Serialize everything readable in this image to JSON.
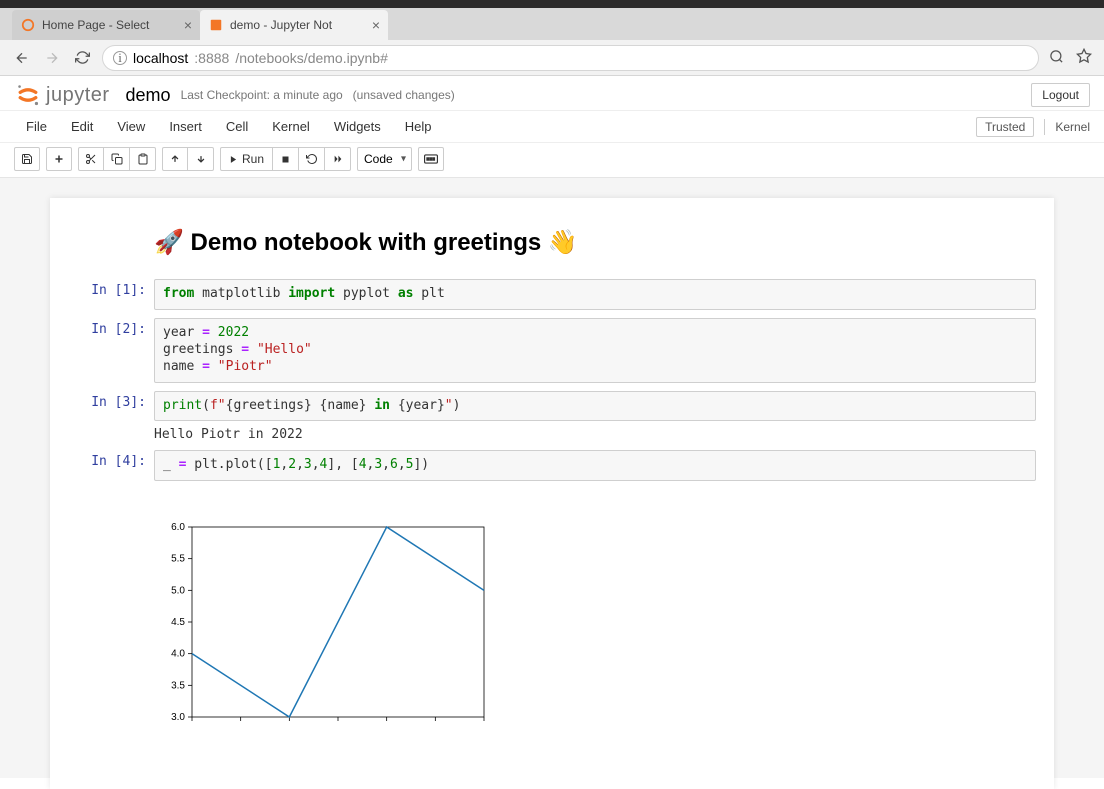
{
  "browser": {
    "tabs": [
      {
        "title": "Home Page - Select",
        "active": false,
        "favicon": "jupyter"
      },
      {
        "title": "demo - Jupyter Not",
        "active": true,
        "favicon": "notebook"
      }
    ],
    "url_host": "localhost",
    "url_port": ":8888",
    "url_path": "/notebooks/demo.ipynb#"
  },
  "header": {
    "logo_text": "jupyter",
    "notebook_name": "demo",
    "checkpoint": "Last Checkpoint: a minute ago",
    "unsaved": "(unsaved changes)",
    "logout": "Logout"
  },
  "menubar": {
    "items": [
      "File",
      "Edit",
      "View",
      "Insert",
      "Cell",
      "Kernel",
      "Widgets",
      "Help"
    ],
    "trusted": "Trusted",
    "kernel": "Kernel"
  },
  "toolbar": {
    "run_label": "Run",
    "cell_type": "Code"
  },
  "notebook": {
    "markdown_title": "🚀 Demo notebook with greetings 👋",
    "cells": [
      {
        "prompt": "In [1]:"
      },
      {
        "prompt": "In [2]:"
      },
      {
        "prompt": "In [3]:",
        "output": "Hello Piotr in 2022"
      },
      {
        "prompt": "In [4]:"
      }
    ]
  },
  "chart_data": {
    "type": "line",
    "x": [
      1,
      2,
      3,
      4
    ],
    "values": [
      4,
      3,
      6,
      5
    ],
    "ylim": [
      3.0,
      6.0
    ],
    "yticks": [
      3.0,
      3.5,
      4.0,
      4.5,
      5.0,
      5.5,
      6.0
    ],
    "title": "",
    "xlabel": "",
    "ylabel": ""
  }
}
